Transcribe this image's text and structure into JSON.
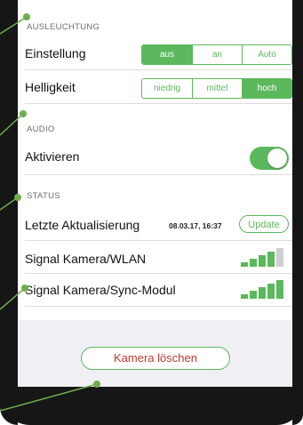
{
  "illumination": {
    "section_header": "AUSLEUCHTUNG",
    "setting_label": "Einstellung",
    "setting_options": [
      "aus",
      "an",
      "Auto"
    ],
    "setting_selected": "aus",
    "brightness_label": "Helligkeit",
    "brightness_options": [
      "niedrig",
      "mittel",
      "hoch"
    ],
    "brightness_selected": "hoch"
  },
  "audio": {
    "section_header": "AUDIO",
    "activate_label": "Aktivieren",
    "activate_on": true
  },
  "status": {
    "section_header": "STATUS",
    "last_update_label": "Letzte Aktualisierung",
    "last_update_value": "08.03.17, 16:37",
    "update_button": "Update",
    "signal_wlan_label": "Signal Kamera/WLAN",
    "signal_wlan_strength": 4,
    "signal_sync_label": "Signal Kamera/Sync-Modul",
    "signal_sync_strength": 5,
    "signal_max": 5
  },
  "actions": {
    "delete_camera": "Kamera löschen"
  },
  "colors": {
    "accent": "#5cb85c",
    "danger": "#c0392b",
    "callout": "#6fae4a"
  }
}
